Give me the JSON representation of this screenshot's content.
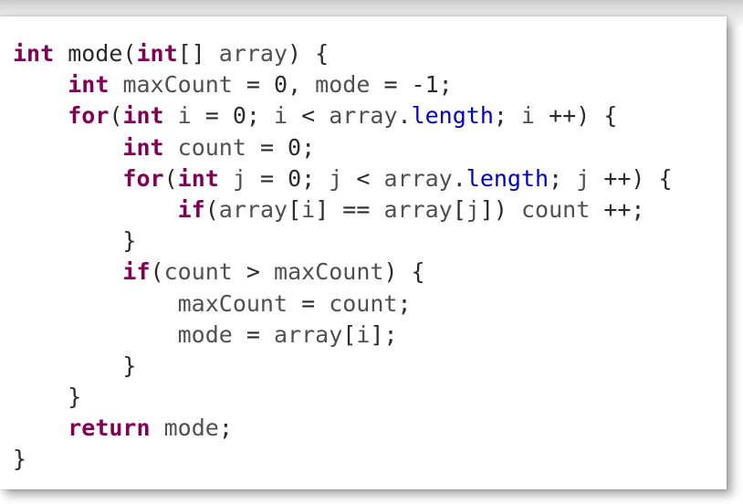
{
  "code": {
    "language": "java",
    "lines": [
      [
        {
          "t": "int",
          "c": "kw"
        },
        {
          "t": " mode(",
          "c": "plain"
        },
        {
          "t": "int",
          "c": "kw"
        },
        {
          "t": "[] ",
          "c": "plain"
        },
        {
          "t": "array",
          "c": "var"
        },
        {
          "t": ") {",
          "c": "plain"
        }
      ],
      [
        {
          "t": "    ",
          "c": "plain"
        },
        {
          "t": "int",
          "c": "kw"
        },
        {
          "t": " ",
          "c": "plain"
        },
        {
          "t": "maxCount",
          "c": "var"
        },
        {
          "t": " = 0, ",
          "c": "plain"
        },
        {
          "t": "mode",
          "c": "var"
        },
        {
          "t": " = -1;",
          "c": "plain"
        }
      ],
      [
        {
          "t": "    ",
          "c": "plain"
        },
        {
          "t": "for",
          "c": "kw"
        },
        {
          "t": "(",
          "c": "plain"
        },
        {
          "t": "int",
          "c": "kw"
        },
        {
          "t": " ",
          "c": "plain"
        },
        {
          "t": "i",
          "c": "var"
        },
        {
          "t": " = 0; ",
          "c": "plain"
        },
        {
          "t": "i",
          "c": "var"
        },
        {
          "t": " < ",
          "c": "plain"
        },
        {
          "t": "array",
          "c": "var"
        },
        {
          "t": ".",
          "c": "plain"
        },
        {
          "t": "length",
          "c": "field"
        },
        {
          "t": "; ",
          "c": "plain"
        },
        {
          "t": "i",
          "c": "var"
        },
        {
          "t": " ++) {",
          "c": "plain"
        }
      ],
      [
        {
          "t": "        ",
          "c": "plain"
        },
        {
          "t": "int",
          "c": "kw"
        },
        {
          "t": " ",
          "c": "plain"
        },
        {
          "t": "count",
          "c": "var"
        },
        {
          "t": " = 0;",
          "c": "plain"
        }
      ],
      [
        {
          "t": "        ",
          "c": "plain"
        },
        {
          "t": "for",
          "c": "kw"
        },
        {
          "t": "(",
          "c": "plain"
        },
        {
          "t": "int",
          "c": "kw"
        },
        {
          "t": " ",
          "c": "plain"
        },
        {
          "t": "j",
          "c": "var"
        },
        {
          "t": " = 0; ",
          "c": "plain"
        },
        {
          "t": "j",
          "c": "var"
        },
        {
          "t": " < ",
          "c": "plain"
        },
        {
          "t": "array",
          "c": "var"
        },
        {
          "t": ".",
          "c": "plain"
        },
        {
          "t": "length",
          "c": "field"
        },
        {
          "t": "; ",
          "c": "plain"
        },
        {
          "t": "j",
          "c": "var"
        },
        {
          "t": " ++) {",
          "c": "plain"
        }
      ],
      [
        {
          "t": "            ",
          "c": "plain"
        },
        {
          "t": "if",
          "c": "kw"
        },
        {
          "t": "(",
          "c": "plain"
        },
        {
          "t": "array",
          "c": "var"
        },
        {
          "t": "[",
          "c": "plain"
        },
        {
          "t": "i",
          "c": "var"
        },
        {
          "t": "] == ",
          "c": "plain"
        },
        {
          "t": "array",
          "c": "var"
        },
        {
          "t": "[",
          "c": "plain"
        },
        {
          "t": "j",
          "c": "var"
        },
        {
          "t": "]) ",
          "c": "plain"
        },
        {
          "t": "count",
          "c": "var"
        },
        {
          "t": " ++;",
          "c": "plain"
        }
      ],
      [
        {
          "t": "        }",
          "c": "plain"
        }
      ],
      [
        {
          "t": "        ",
          "c": "plain"
        },
        {
          "t": "if",
          "c": "kw"
        },
        {
          "t": "(",
          "c": "plain"
        },
        {
          "t": "count",
          "c": "var"
        },
        {
          "t": " > ",
          "c": "plain"
        },
        {
          "t": "maxCount",
          "c": "var"
        },
        {
          "t": ") {",
          "c": "plain"
        }
      ],
      [
        {
          "t": "            ",
          "c": "plain"
        },
        {
          "t": "maxCount",
          "c": "var"
        },
        {
          "t": " = ",
          "c": "plain"
        },
        {
          "t": "count",
          "c": "var"
        },
        {
          "t": ";",
          "c": "plain"
        }
      ],
      [
        {
          "t": "            ",
          "c": "plain"
        },
        {
          "t": "mode",
          "c": "var"
        },
        {
          "t": " = ",
          "c": "plain"
        },
        {
          "t": "array",
          "c": "var"
        },
        {
          "t": "[",
          "c": "plain"
        },
        {
          "t": "i",
          "c": "var"
        },
        {
          "t": "];",
          "c": "plain"
        }
      ],
      [
        {
          "t": "        }",
          "c": "plain"
        }
      ],
      [
        {
          "t": "    }",
          "c": "plain"
        }
      ],
      [
        {
          "t": "    ",
          "c": "plain"
        },
        {
          "t": "return",
          "c": "kw"
        },
        {
          "t": " ",
          "c": "plain"
        },
        {
          "t": "mode",
          "c": "var"
        },
        {
          "t": ";",
          "c": "plain"
        }
      ],
      [
        {
          "t": "}",
          "c": "plain"
        }
      ]
    ]
  },
  "colors": {
    "keyword": "#7f0055",
    "field": "#0000c0",
    "text": "#2b2b2b",
    "background": "#ffffff"
  }
}
